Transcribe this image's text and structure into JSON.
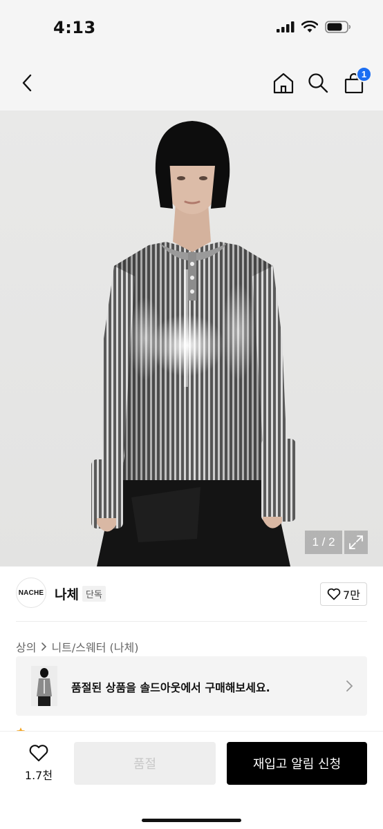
{
  "status": {
    "time": "4:13"
  },
  "nav": {
    "cart_count": "1"
  },
  "image": {
    "counter": "1 / 2"
  },
  "brand": {
    "logo_text": "NACHE",
    "name": "나체",
    "tag": "단독",
    "likes": "7만"
  },
  "breadcrumb": {
    "category": "상의",
    "subcategory": "니트/스웨터 (나체)"
  },
  "banner": {
    "text": "품절된 상품을 솔드아웃에서 구매해보세요."
  },
  "bottom": {
    "wish_count": "1.7천",
    "soldout_label": "품절",
    "restock_label": "재입고 알림 신청"
  },
  "colors": {
    "accent": "#1c6ef2",
    "primary_button": "#000000"
  }
}
